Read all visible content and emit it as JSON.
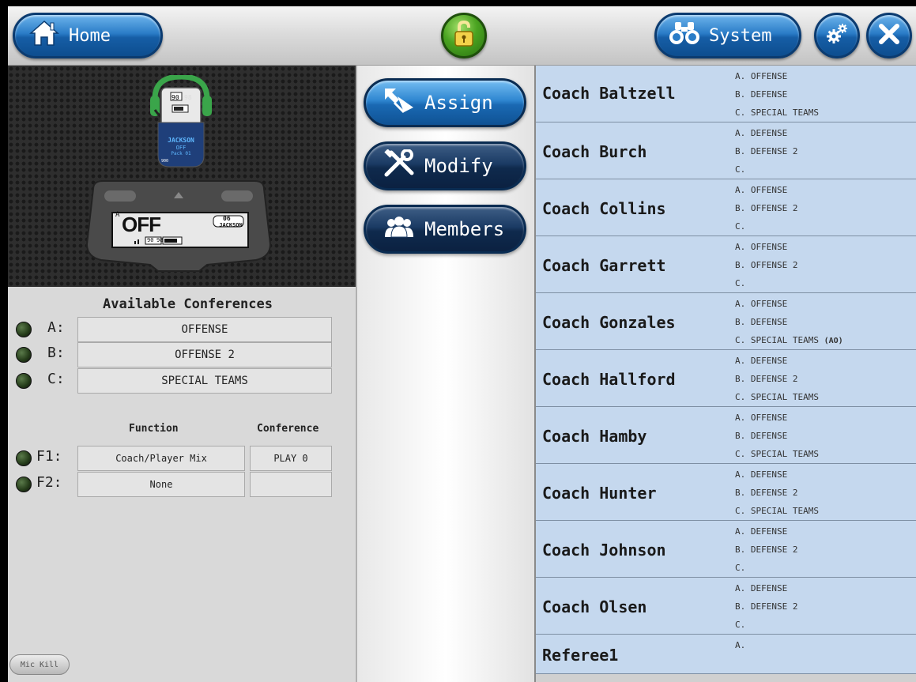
{
  "header": {
    "home_label": "Home",
    "system_label": "System"
  },
  "device": {
    "headset": {
      "display_a": "90",
      "display_b": "98",
      "name": "JACKSON",
      "mode": "OFF",
      "pack": "Pack 01",
      "id": "900"
    },
    "beltpack": {
      "status": "OFF",
      "status_prefix": "A",
      "channel": "06",
      "name": "JACKSON",
      "display_a": "90",
      "display_b": "98"
    }
  },
  "conferences": {
    "title": "Available Conferences",
    "items": [
      {
        "letter": "A:",
        "value": "OFFENSE"
      },
      {
        "letter": "B:",
        "value": "OFFENSE 2"
      },
      {
        "letter": "C:",
        "value": "SPECIAL TEAMS"
      }
    ]
  },
  "functions": {
    "function_header": "Function",
    "conference_header": "Conference",
    "items": [
      {
        "label": "F1:",
        "function": "Coach/Player Mix",
        "conference": "PLAY 0"
      },
      {
        "label": "F2:",
        "function": "None",
        "conference": ""
      }
    ]
  },
  "mic_kill_label": "Mic Kill",
  "actions": {
    "assign_label": "Assign",
    "modify_label": "Modify",
    "members_label": "Members"
  },
  "coaches": [
    {
      "name": "Coach Baltzell",
      "a": "A. OFFENSE",
      "b": "B. DEFENSE",
      "c": "C. SPECIAL TEAMS",
      "c_tag": ""
    },
    {
      "name": "Coach Burch",
      "a": "A. DEFENSE",
      "b": "B. DEFENSE 2",
      "c": "C.",
      "c_tag": ""
    },
    {
      "name": "Coach Collins",
      "a": "A. OFFENSE",
      "b": "B. OFFENSE 2",
      "c": "C.",
      "c_tag": ""
    },
    {
      "name": "Coach Garrett",
      "a": "A. OFFENSE",
      "b": "B. OFFENSE 2",
      "c": "C.",
      "c_tag": ""
    },
    {
      "name": "Coach Gonzales",
      "a": "A. OFFENSE",
      "b": "B. DEFENSE",
      "c": "C. SPECIAL TEAMS",
      "c_tag": "(AO)"
    },
    {
      "name": "Coach Hallford",
      "a": "A. DEFENSE",
      "b": "B. DEFENSE 2",
      "c": "C. SPECIAL TEAMS",
      "c_tag": ""
    },
    {
      "name": "Coach Hamby",
      "a": "A. OFFENSE",
      "b": "B. DEFENSE",
      "c": "C. SPECIAL TEAMS",
      "c_tag": ""
    },
    {
      "name": "Coach Hunter",
      "a": "A. DEFENSE",
      "b": "B. DEFENSE 2",
      "c": "C. SPECIAL TEAMS",
      "c_tag": ""
    },
    {
      "name": "Coach Johnson",
      "a": "A. DEFENSE",
      "b": "B. DEFENSE 2",
      "c": "C.",
      "c_tag": ""
    },
    {
      "name": "Coach Olsen",
      "a": "A. DEFENSE",
      "b": "B. DEFENSE 2",
      "c": "C.",
      "c_tag": ""
    },
    {
      "name": "Referee1",
      "a": "A.",
      "b": "",
      "c": "",
      "c_tag": ""
    }
  ]
}
